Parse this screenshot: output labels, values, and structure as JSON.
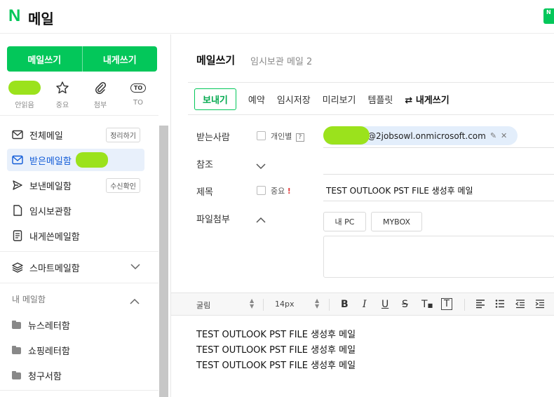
{
  "header": {
    "logo_letter": "N",
    "logo_title": "메일",
    "corner_badge": "N"
  },
  "sidebar": {
    "compose_label": "메일쓰기",
    "self_compose_label": "내게쓰기",
    "quick": {
      "unread_label": "안읽음",
      "important_label": "중요",
      "attach_label": "첨부",
      "to_label": "TO",
      "to_icon_text": "TO"
    },
    "items": [
      {
        "label": "전체메일",
        "action": "정리하기"
      },
      {
        "label": "받은메일함"
      },
      {
        "label": "보낸메일함",
        "action": "수신확인"
      },
      {
        "label": "임시보관함"
      },
      {
        "label": "내게쓴메일함"
      }
    ],
    "smart_label": "스마트메일함",
    "my_mailbox_label": "내 메일함",
    "folders": [
      "뉴스레터함",
      "쇼핑레터함",
      "청구서함"
    ]
  },
  "compose": {
    "title": "메일쓰기",
    "subtitle": "임시보관 메일 2",
    "toolbar": {
      "send": "보내기",
      "schedule": "예약",
      "save_draft": "임시저장",
      "preview": "미리보기",
      "template": "템플릿",
      "self_compose": "내게쓰기"
    },
    "labels": {
      "to": "받는사람",
      "cc": "참조",
      "subject": "제목",
      "attachment": "파일첨부"
    },
    "individual_label": "개인별",
    "individual_help": "?",
    "important_label": "중요",
    "important_mark": "!",
    "recipient_domain": "@2jobsowl.onmicrosoft.com",
    "subject_value": "TEST OUTLOOK PST FILE 생성후 메일",
    "attach_buttons": {
      "my_pc": "내 PC",
      "mybox": "MYBOX"
    },
    "editor": {
      "font": "굴림",
      "size": "14px"
    },
    "body_lines": [
      "TEST OUTLOOK PST FILE 생성후 메일",
      "TEST OUTLOOK PST FILE 생성후 메일",
      "TEST OUTLOOK PST FILE 생성후 메일"
    ]
  },
  "colors": {
    "brand": "#03c75a",
    "active_bg": "#e8f0fb",
    "active_text": "#0f5ad7",
    "redaction": "#9be21c"
  }
}
